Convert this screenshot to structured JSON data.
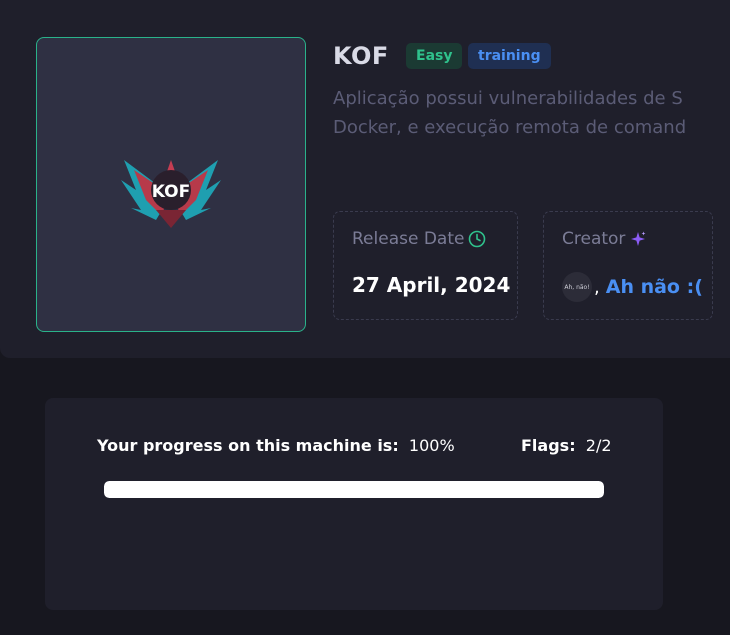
{
  "machine": {
    "title": "KOF",
    "logo_text": "KOF",
    "difficulty": "Easy",
    "category": "training",
    "description_line1": "Aplicação possui vulnerabilidades de S",
    "description_line2": "Docker, e execução remota de comand"
  },
  "release": {
    "label": "Release Date",
    "value": "27 April, 2024",
    "icon": "clock-icon"
  },
  "creator": {
    "label": "Creator",
    "icon": "sparkle-icon",
    "avatar_text": "Ah, não!",
    "comma": ",",
    "name": "Ah não :("
  },
  "progress": {
    "label": "Your progress on this machine is:",
    "value_text": "100%",
    "fraction": 1.0,
    "flags_label": "Flags:",
    "flags_value": "2/2"
  },
  "colors": {
    "accent_green": "#2fc18c",
    "accent_blue": "#4a8ff3",
    "sparkle_purple": "#8b5cf6"
  }
}
